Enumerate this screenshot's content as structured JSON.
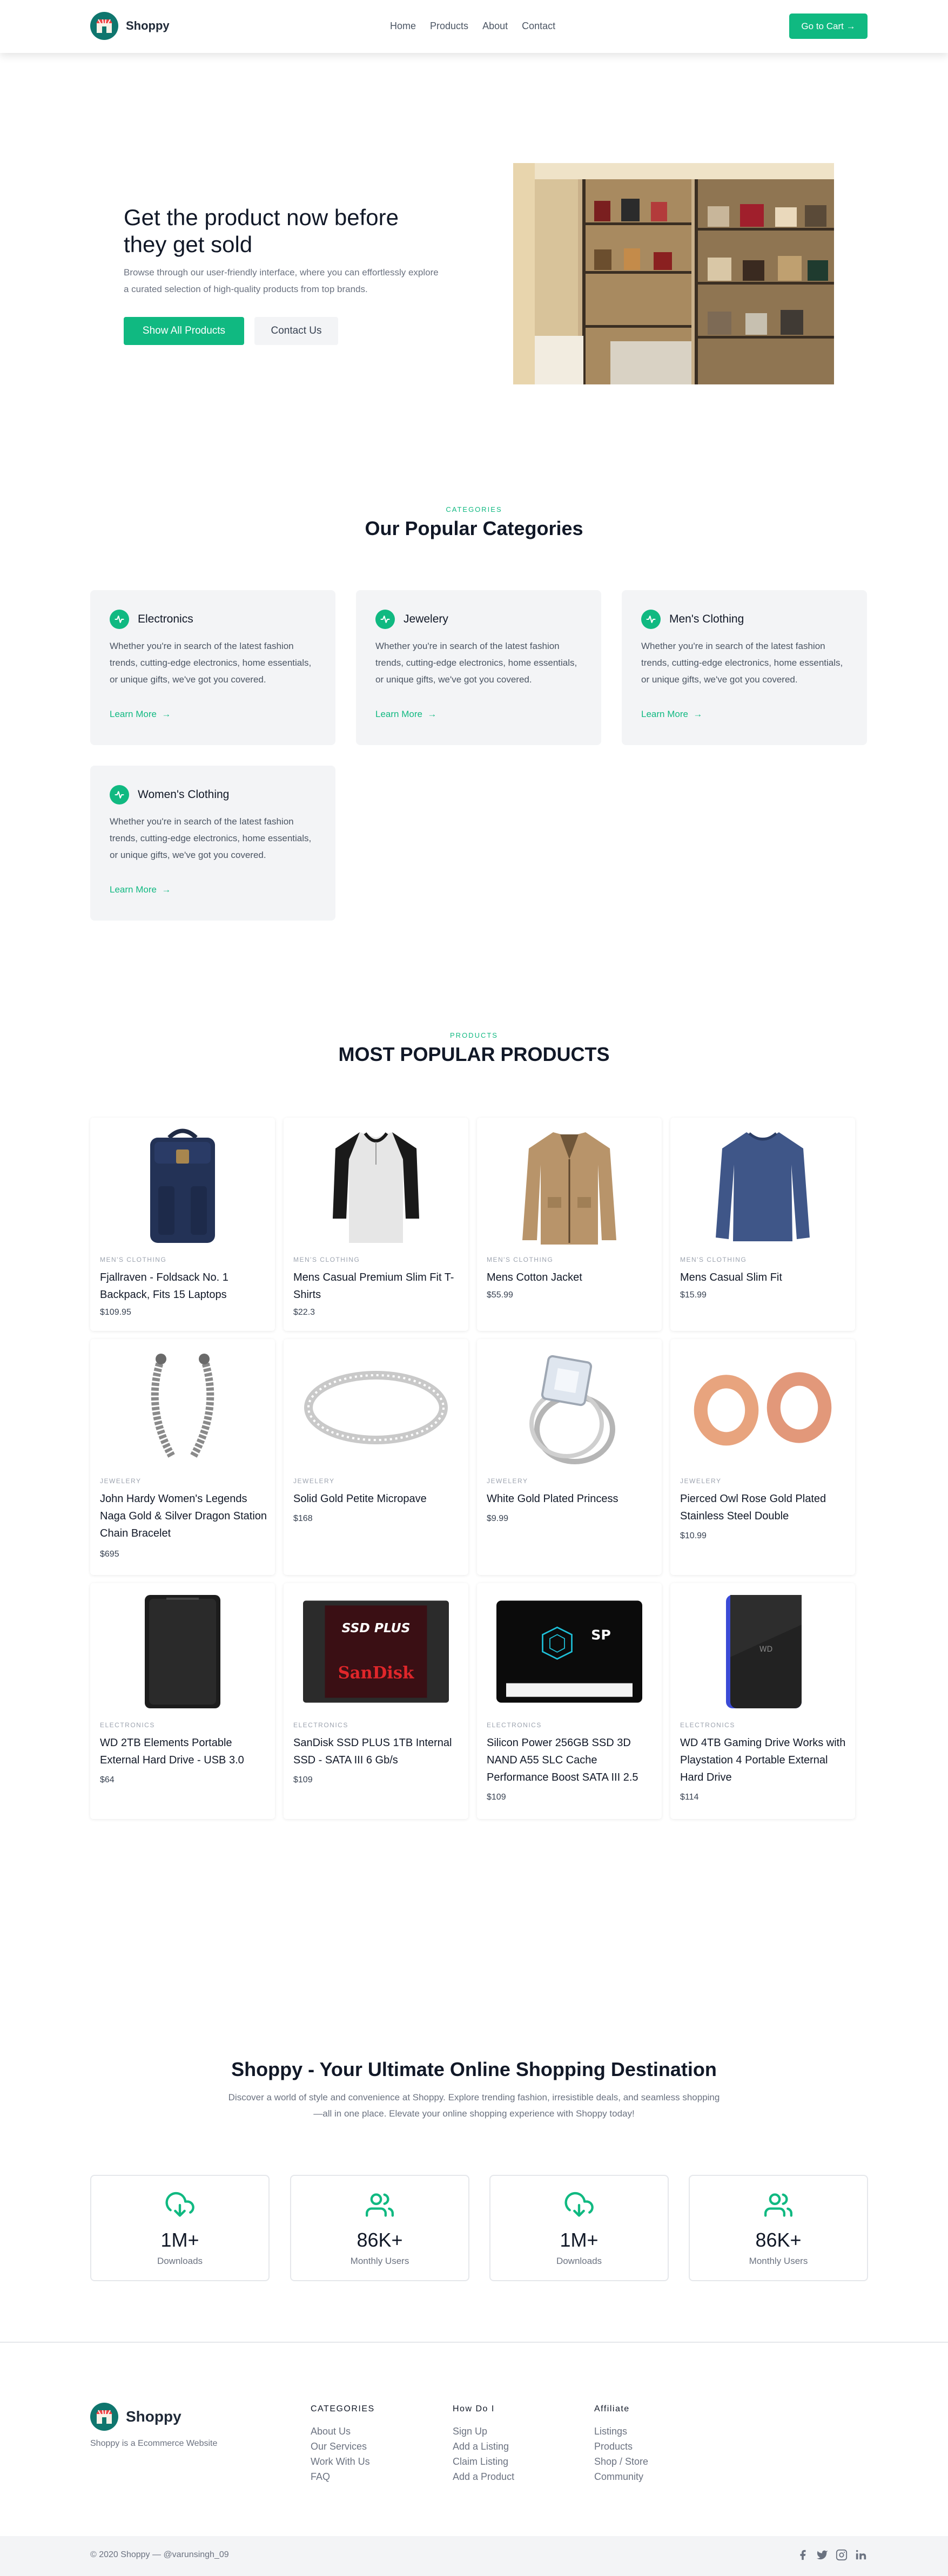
{
  "header": {
    "brand": "Shoppy",
    "nav": [
      "Home",
      "Products",
      "About",
      "Contact"
    ],
    "cart_label": "Go to Cart →"
  },
  "hero": {
    "title": "Get the product now before they get sold",
    "subtitle": "Browse through our user-friendly interface, where you can effortlessly explore a curated selection of high-quality products from top brands.",
    "primary_button": "Show All Products",
    "secondary_button": "Contact Us"
  },
  "categories": {
    "eyebrow": "CATEGORIES",
    "title": "Our Popular Categories",
    "items": [
      {
        "name": "Electronics",
        "description": "Whether you're in search of the latest fashion trends, cutting-edge electronics, home essentials, or unique gifts, we've got you covered.",
        "link": "Learn More"
      },
      {
        "name": "Jewelery",
        "description": "Whether you're in search of the latest fashion trends, cutting-edge electronics, home essentials, or unique gifts, we've got you covered.",
        "link": "Learn More"
      },
      {
        "name": "Men's Clothing",
        "description": "Whether you're in search of the latest fashion trends, cutting-edge electronics, home essentials, or unique gifts, we've got you covered.",
        "link": "Learn More"
      },
      {
        "name": "Women's Clothing",
        "description": "Whether you're in search of the latest fashion trends, cutting-edge electronics, home essentials, or unique gifts, we've got you covered.",
        "link": "Learn More"
      }
    ]
  },
  "products": {
    "eyebrow": "PRODUCTS",
    "title": "MOST POPULAR PRODUCTS",
    "items": [
      {
        "category": "MEN'S CLOTHING",
        "title": "Fjallraven - Foldsack No. 1 Backpack, Fits 15 Laptops",
        "price": "$109.95"
      },
      {
        "category": "MEN'S CLOTHING",
        "title": "Mens Casual Premium Slim Fit T-Shirts",
        "price": "$22.3"
      },
      {
        "category": "MEN'S CLOTHING",
        "title": "Mens Cotton Jacket",
        "price": "$55.99"
      },
      {
        "category": "MEN'S CLOTHING",
        "title": "Mens Casual Slim Fit",
        "price": "$15.99"
      },
      {
        "category": "JEWELERY",
        "title": "John Hardy Women's Legends Naga Gold & Silver Dragon Station Chain Bracelet",
        "price": "$695"
      },
      {
        "category": "JEWELERY",
        "title": "Solid Gold Petite Micropave",
        "price": "$168"
      },
      {
        "category": "JEWELERY",
        "title": "White Gold Plated Princess",
        "price": "$9.99"
      },
      {
        "category": "JEWELERY",
        "title": "Pierced Owl Rose Gold Plated Stainless Steel Double",
        "price": "$10.99"
      },
      {
        "category": "ELECTRONICS",
        "title": "WD 2TB Elements Portable External Hard Drive - USB 3.0",
        "price": "$64"
      },
      {
        "category": "ELECTRONICS",
        "title": "SanDisk SSD PLUS 1TB Internal SSD - SATA III 6 Gb/s",
        "price": "$109"
      },
      {
        "category": "ELECTRONICS",
        "title": "Silicon Power 256GB SSD 3D NAND A55 SLC Cache Performance Boost SATA III 2.5",
        "price": "$109"
      },
      {
        "category": "ELECTRONICS",
        "title": "WD 4TB Gaming Drive Works with Playstation 4 Portable External Hard Drive",
        "price": "$114"
      }
    ]
  },
  "about": {
    "title": "Shoppy - Your Ultimate Online Shopping Destination",
    "subtitle": "Discover a world of style and convenience at Shoppy. Explore trending fashion, irresistible deals, and seamless shopping—all in one place. Elevate your online shopping experience with Shoppy today!",
    "stats": [
      {
        "icon": "cloud-download-icon",
        "value": "1M+",
        "label": "Downloads"
      },
      {
        "icon": "users-icon",
        "value": "86K+",
        "label": "Monthly Users"
      },
      {
        "icon": "cloud-download-icon",
        "value": "1M+",
        "label": "Downloads"
      },
      {
        "icon": "users-icon",
        "value": "86K+",
        "label": "Monthly Users"
      }
    ]
  },
  "footer": {
    "brand": "Shoppy",
    "tagline": "Shoppy is a Ecommerce Website",
    "columns": [
      {
        "title": "CATEGORIES",
        "links": [
          "About Us",
          "Our Services",
          "Work With Us",
          "FAQ"
        ]
      },
      {
        "title": "How Do I",
        "links": [
          "Sign Up",
          "Add a Listing",
          "Claim Listing",
          "Add a Product"
        ]
      },
      {
        "title": "Affiliate",
        "links": [
          "Listings",
          "Products",
          "Shop / Store",
          "Community"
        ]
      }
    ],
    "copyright": "© 2020 Shoppy —",
    "handle": "@varunsingh_09",
    "socials": [
      "facebook-icon",
      "twitter-icon",
      "instagram-icon",
      "linkedin-icon"
    ]
  },
  "colors": {
    "accent": "#10b981",
    "text": "#111827",
    "muted": "#6b7280",
    "card_bg": "#f3f4f6"
  }
}
